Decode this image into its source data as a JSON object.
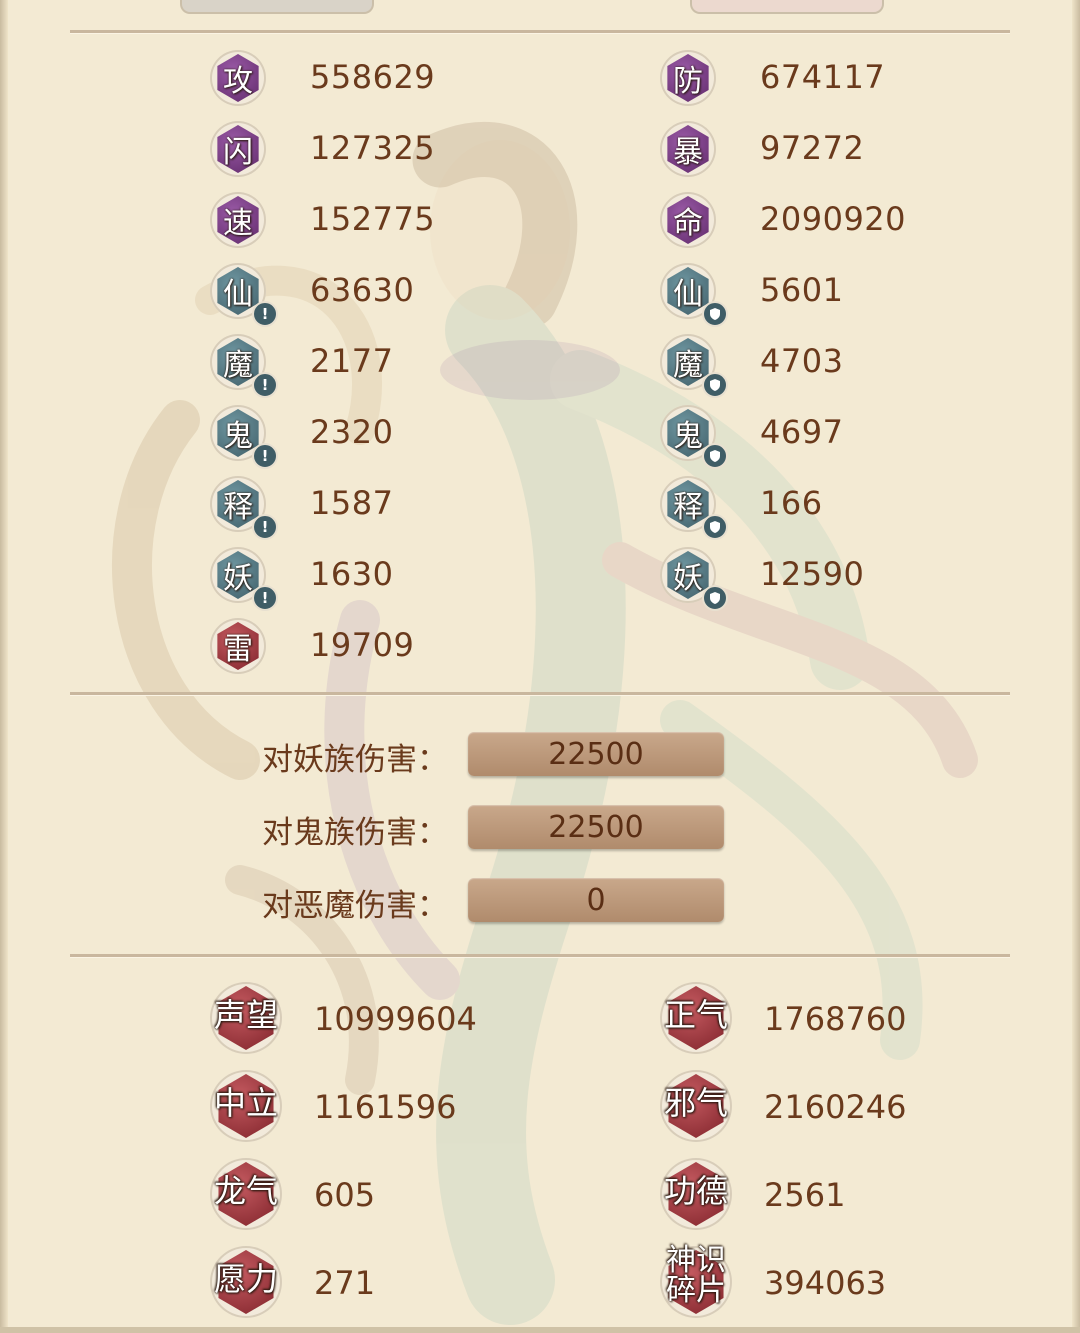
{
  "attributes_left": [
    {
      "char": "攻",
      "value": "558629",
      "color": "purple",
      "mark": "none"
    },
    {
      "char": "闪",
      "value": "127325",
      "color": "purple",
      "mark": "none"
    },
    {
      "char": "速",
      "value": "152775",
      "color": "purple",
      "mark": "none"
    },
    {
      "char": "仙",
      "value": "63630",
      "color": "teal",
      "mark": "!"
    },
    {
      "char": "魔",
      "value": "2177",
      "color": "teal",
      "mark": "!"
    },
    {
      "char": "鬼",
      "value": "2320",
      "color": "teal",
      "mark": "!"
    },
    {
      "char": "释",
      "value": "1587",
      "color": "teal",
      "mark": "!"
    },
    {
      "char": "妖",
      "value": "1630",
      "color": "teal",
      "mark": "!"
    },
    {
      "char": "雷",
      "value": "19709",
      "color": "red",
      "mark": "none"
    }
  ],
  "attributes_right": [
    {
      "char": "防",
      "value": "674117",
      "color": "purple",
      "mark": "none"
    },
    {
      "char": "暴",
      "value": "97272",
      "color": "purple",
      "mark": "none"
    },
    {
      "char": "命",
      "value": "2090920",
      "color": "purple",
      "mark": "none"
    },
    {
      "char": "仙",
      "value": "5601",
      "color": "teal",
      "mark": "shield"
    },
    {
      "char": "魔",
      "value": "4703",
      "color": "teal",
      "mark": "shield"
    },
    {
      "char": "鬼",
      "value": "4697",
      "color": "teal",
      "mark": "shield"
    },
    {
      "char": "释",
      "value": "166",
      "color": "teal",
      "mark": "shield"
    },
    {
      "char": "妖",
      "value": "12590",
      "color": "teal",
      "mark": "shield"
    }
  ],
  "damage": [
    {
      "label": "对妖族伤害：",
      "value": "22500"
    },
    {
      "label": "对鬼族伤害：",
      "value": "22500"
    },
    {
      "label": "对恶魔伤害：",
      "value": "0"
    }
  ],
  "resources_left": [
    {
      "label": "声望",
      "value": "10999604"
    },
    {
      "label": "中立",
      "value": "1161596"
    },
    {
      "label": "龙气",
      "value": "605"
    },
    {
      "label": "愿力",
      "value": "271"
    }
  ],
  "resources_right": [
    {
      "label": "正气",
      "value": "1768760"
    },
    {
      "label": "邪气",
      "value": "2160246"
    },
    {
      "label": "功德",
      "value": "2561"
    },
    {
      "label": "神识碎片",
      "value": "394063"
    }
  ],
  "colors": {
    "background": "#f3ead3",
    "text": "#6a3a1c",
    "purple_badge": "#7a3d86",
    "teal_badge": "#4f707a",
    "red_badge": "#a03a42",
    "value_box": "#bd9878"
  }
}
